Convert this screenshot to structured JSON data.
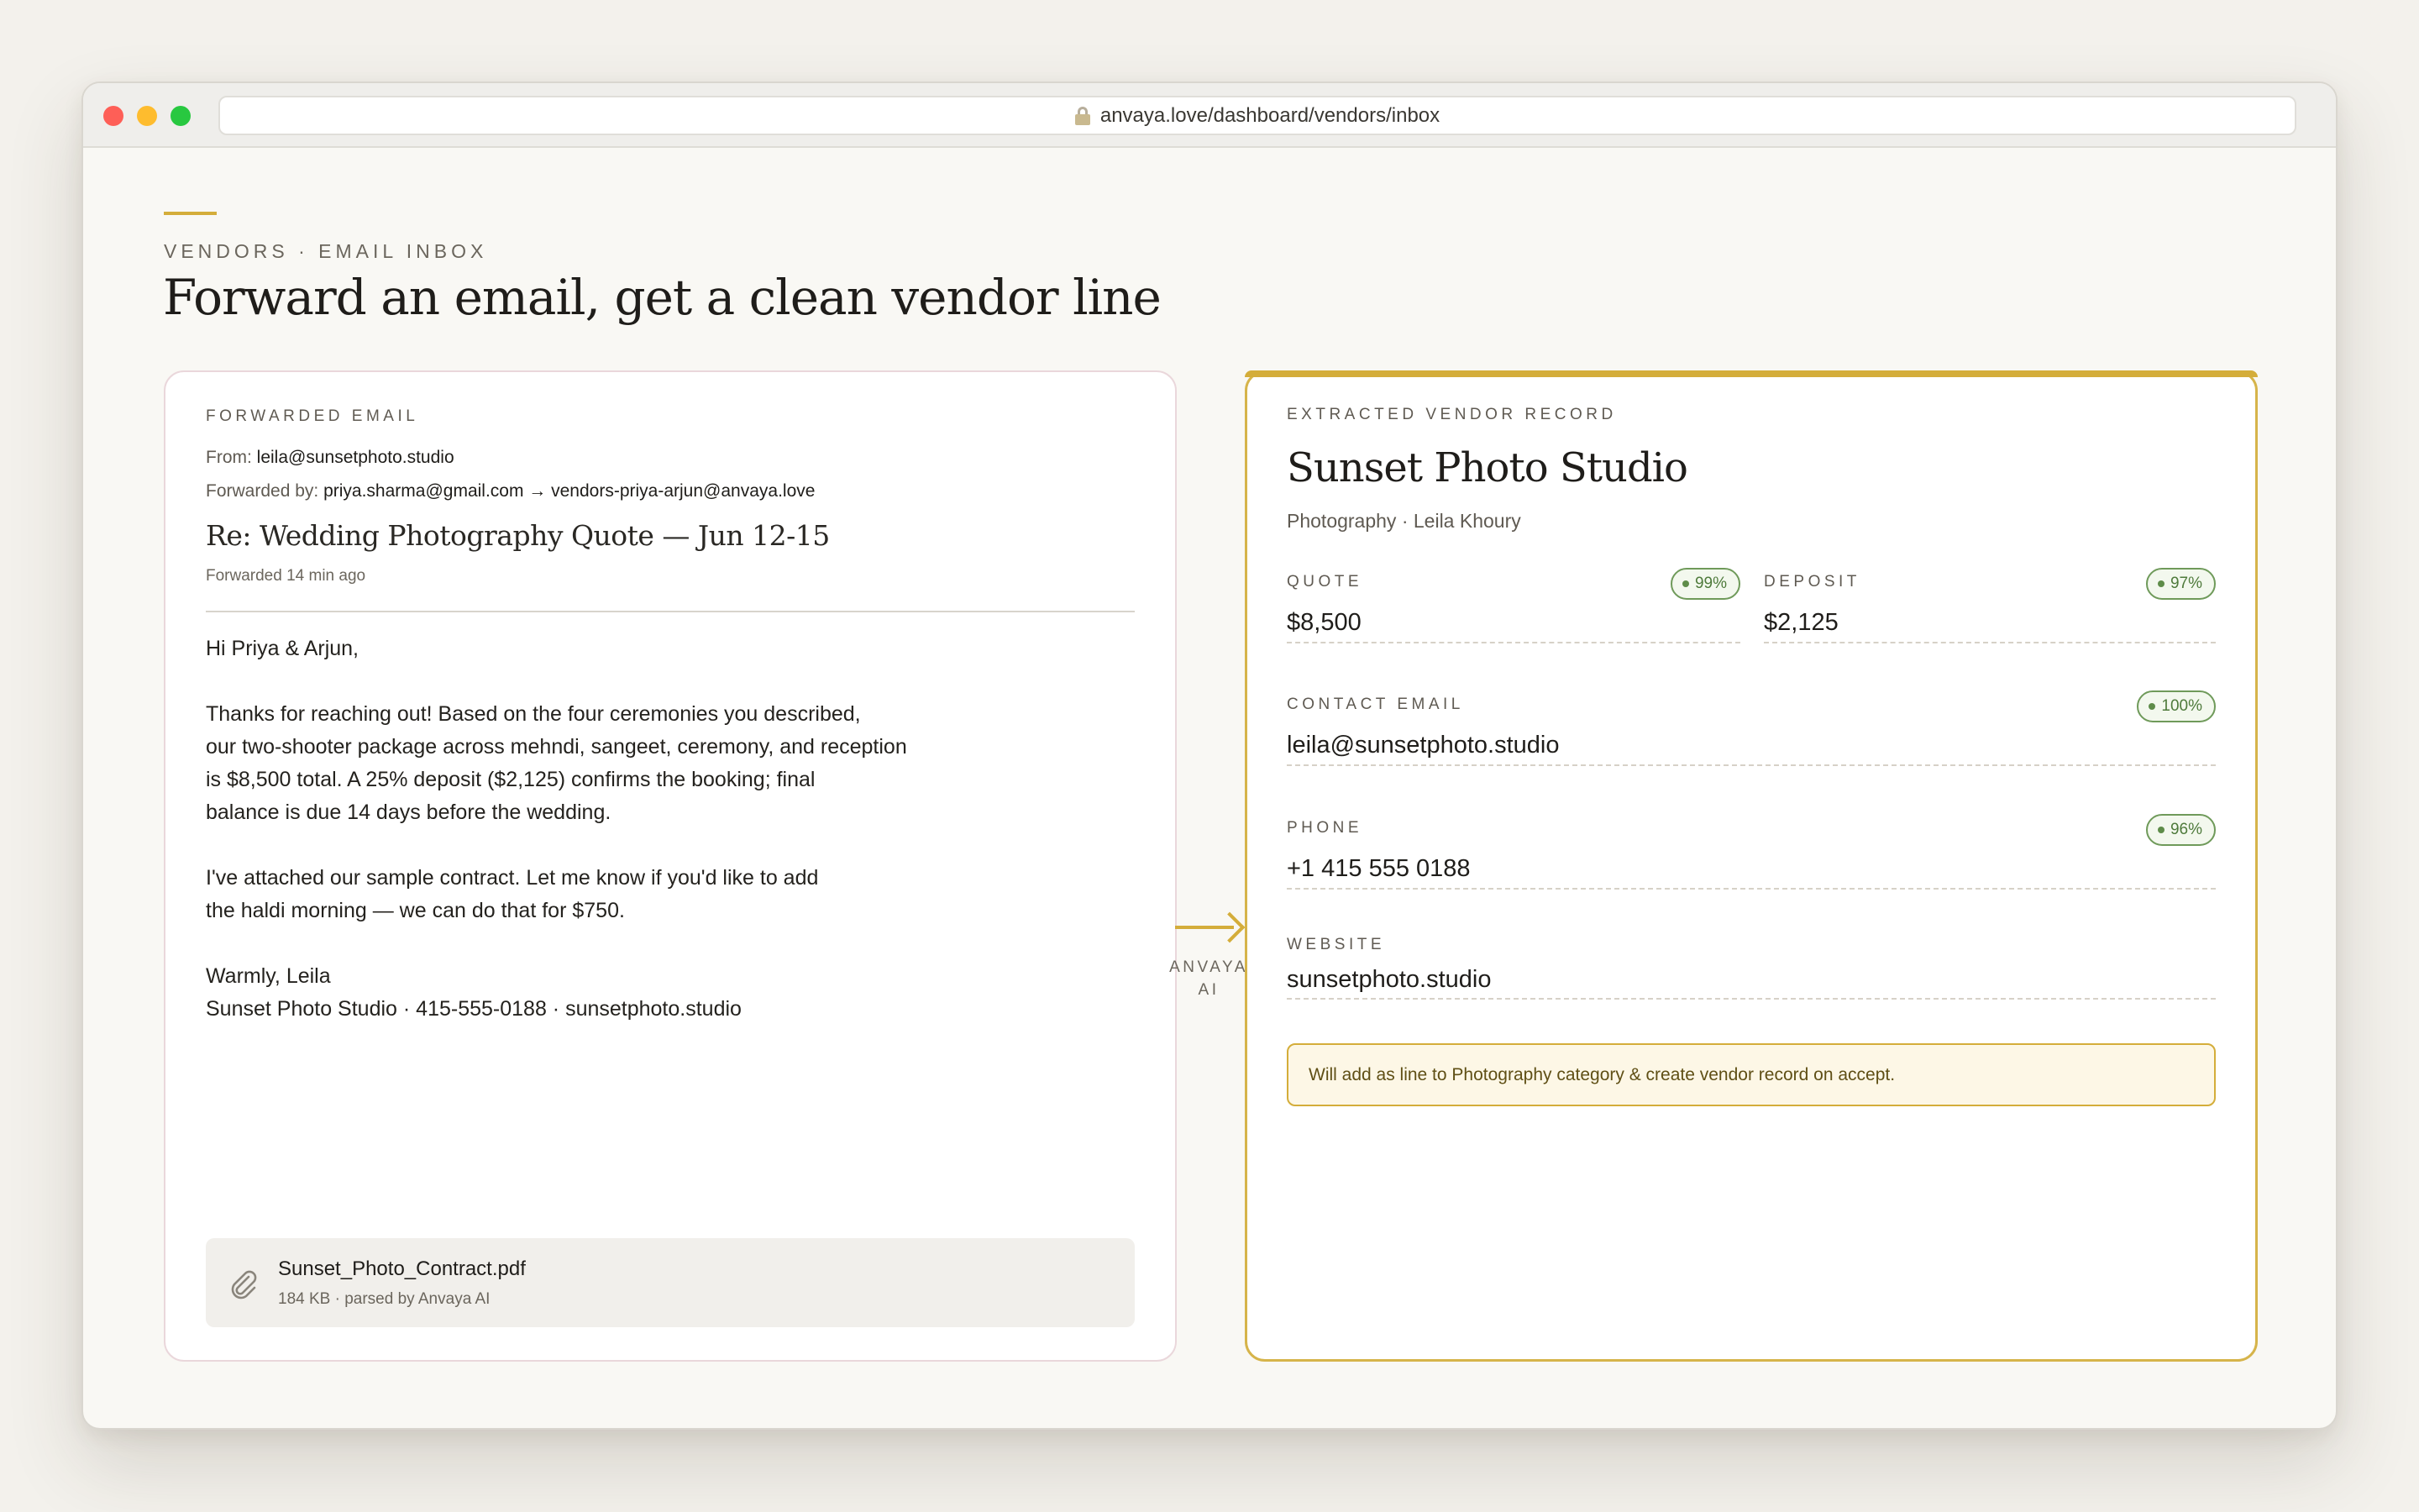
{
  "browser": {
    "url": "anvaya.love/dashboard/vendors/inbox"
  },
  "page": {
    "eyebrow": "VENDORS · EMAIL INBOX",
    "title": "Forward an email, get a clean vendor line"
  },
  "email": {
    "section_label": "FORWARDED EMAIL",
    "from_label": "From:",
    "from_value": "leila@sunsetphoto.studio",
    "forwarded_by_label": "Forwarded by:",
    "forwarded_by_value": "priya.sharma@gmail.com → vendors-priya-arjun@anvaya.love",
    "subject": "Re: Wedding Photography Quote — Jun 12-15",
    "time": "Forwarded 14 min ago",
    "body": {
      "greeting": "Hi Priya & Arjun,",
      "para1": {
        "l1": "Thanks for reaching out! Based on the four ceremonies you described,",
        "l2": "our two-shooter package across mehndi, sangeet, ceremony, and reception",
        "l3": "is $8,500 total. A 25% deposit ($2,125) confirms the booking; final",
        "l4": "balance is due 14 days before the wedding."
      },
      "para2": {
        "l1": "I've attached our sample contract. Let me know if you'd like to add",
        "l2": "the haldi morning — we can do that for $750."
      },
      "signoff": {
        "l1": "Warmly, Leila",
        "l2": "Sunset Photo Studio · 415-555-0188 · sunsetphoto.studio"
      }
    },
    "attachment": {
      "name": "Sunset_Photo_Contract.pdf",
      "meta": "184 KB · parsed by Anvaya AI",
      "icon": "paperclip-icon"
    }
  },
  "connector": {
    "line1": "ANVAYA",
    "line2": "AI",
    "icon": "arrow-right-icon"
  },
  "record": {
    "section_label": "EXTRACTED VENDOR RECORD",
    "vendor_name": "Sunset Photo Studio",
    "vendor_sub": "Photography · Leila Khoury",
    "fields": {
      "quote": {
        "label": "QUOTE",
        "value": "$8,500",
        "confidence": "99%"
      },
      "deposit": {
        "label": "DEPOSIT",
        "value": "$2,125",
        "confidence": "97%"
      },
      "contact_email": {
        "label": "CONTACT EMAIL",
        "value": "leila@sunsetphoto.studio",
        "confidence": "100%"
      },
      "phone": {
        "label": "PHONE",
        "value": "+1 415 555 0188",
        "confidence": "96%"
      },
      "website": {
        "label": "WEBSITE",
        "value": "sunsetphoto.studio"
      }
    },
    "notice": "Will add as line to Photography category & create vendor record on accept."
  },
  "colors": {
    "accent": "#d4ad3a",
    "confidence_green": "#4e7a3b",
    "background": "#f9f8f4"
  }
}
